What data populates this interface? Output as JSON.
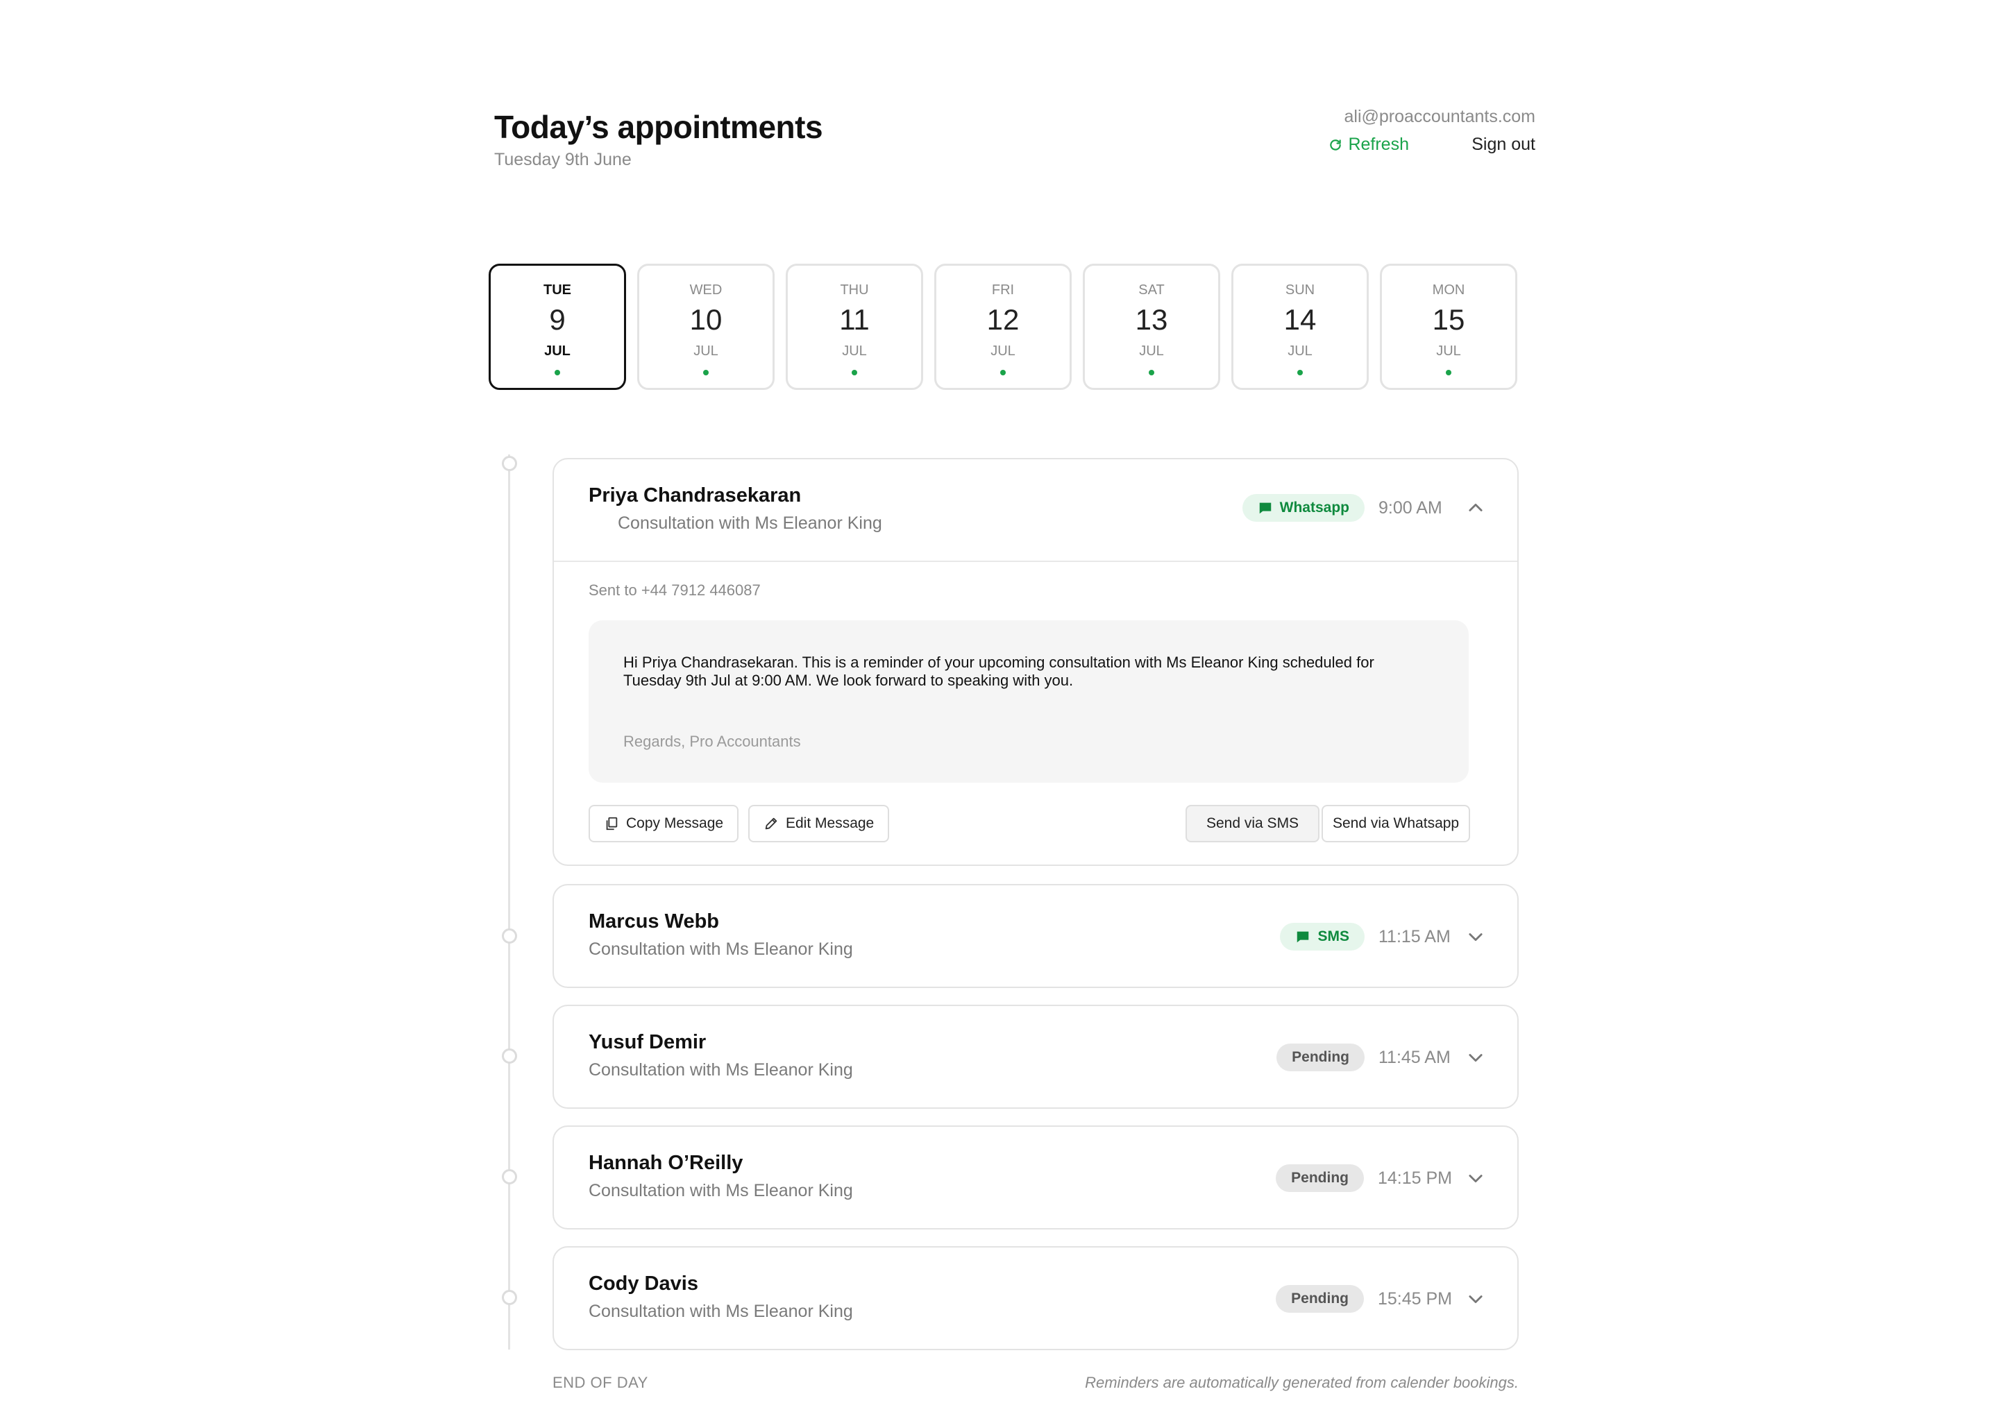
{
  "header": {
    "title": "Today’s appointments",
    "subtitle": "Tuesday 9th June",
    "email": "ali@proaccountants.com",
    "refresh_label": "Refresh",
    "signout_label": "Sign out"
  },
  "days": [
    {
      "name": "TUE",
      "num": "9",
      "month": "JUL",
      "active": true
    },
    {
      "name": "WED",
      "num": "10",
      "month": "JUL",
      "active": false
    },
    {
      "name": "THU",
      "num": "11",
      "month": "JUL",
      "active": false
    },
    {
      "name": "FRI",
      "num": "12",
      "month": "JUL",
      "active": false
    },
    {
      "name": "SAT",
      "num": "13",
      "month": "JUL",
      "active": false
    },
    {
      "name": "SUN",
      "num": "14",
      "month": "JUL",
      "active": false
    },
    {
      "name": "MON",
      "num": "15",
      "month": "JUL",
      "active": false
    }
  ],
  "appointments": [
    {
      "name": "Priya Chandrasekaran",
      "subtitle": "Consultation with Ms Eleanor King",
      "badge": "Whatsapp",
      "badge_icon": "chat-icon",
      "time": "9:00 AM",
      "expanded": true,
      "sent_to": "Sent to +44 7912 446087",
      "message": "Hi Priya Chandrasekaran. This is a reminder of your upcoming consultation with Ms Eleanor King scheduled for Tuesday 9th Jul at 9:00 AM. We look forward to speaking with you.",
      "signature": "Regards, Pro Accountants",
      "actions": {
        "copy": "Copy Message",
        "edit": "Edit Message",
        "send_sms": "Send via SMS",
        "send_whatsapp": "Send via Whatsapp"
      }
    },
    {
      "name": "Marcus Webb",
      "subtitle": "Consultation with Ms Eleanor King",
      "badge": "SMS",
      "badge_icon": "chat-icon",
      "time": "11:15 AM",
      "expanded": false
    },
    {
      "name": "Yusuf Demir",
      "subtitle": "Consultation with Ms Eleanor King",
      "badge": "Pending",
      "time": "11:45 AM",
      "expanded": false
    },
    {
      "name": "Hannah O’Reilly",
      "subtitle": "Consultation with Ms Eleanor King",
      "badge": "Pending",
      "time": "14:15 PM",
      "expanded": false
    },
    {
      "name": "Cody Davis",
      "subtitle": "Consultation with Ms Eleanor King",
      "badge": "Pending",
      "time": "15:45 PM",
      "expanded": false
    }
  ],
  "footer": {
    "left": "END OF DAY",
    "right": "Reminders are automatically generated from calender bookings."
  },
  "colors": {
    "accent_green": "#1aa34a",
    "badge_green_bg": "#e6f6ec",
    "badge_pending_bg": "#e7e7e7",
    "border": "#e3e3e3"
  }
}
